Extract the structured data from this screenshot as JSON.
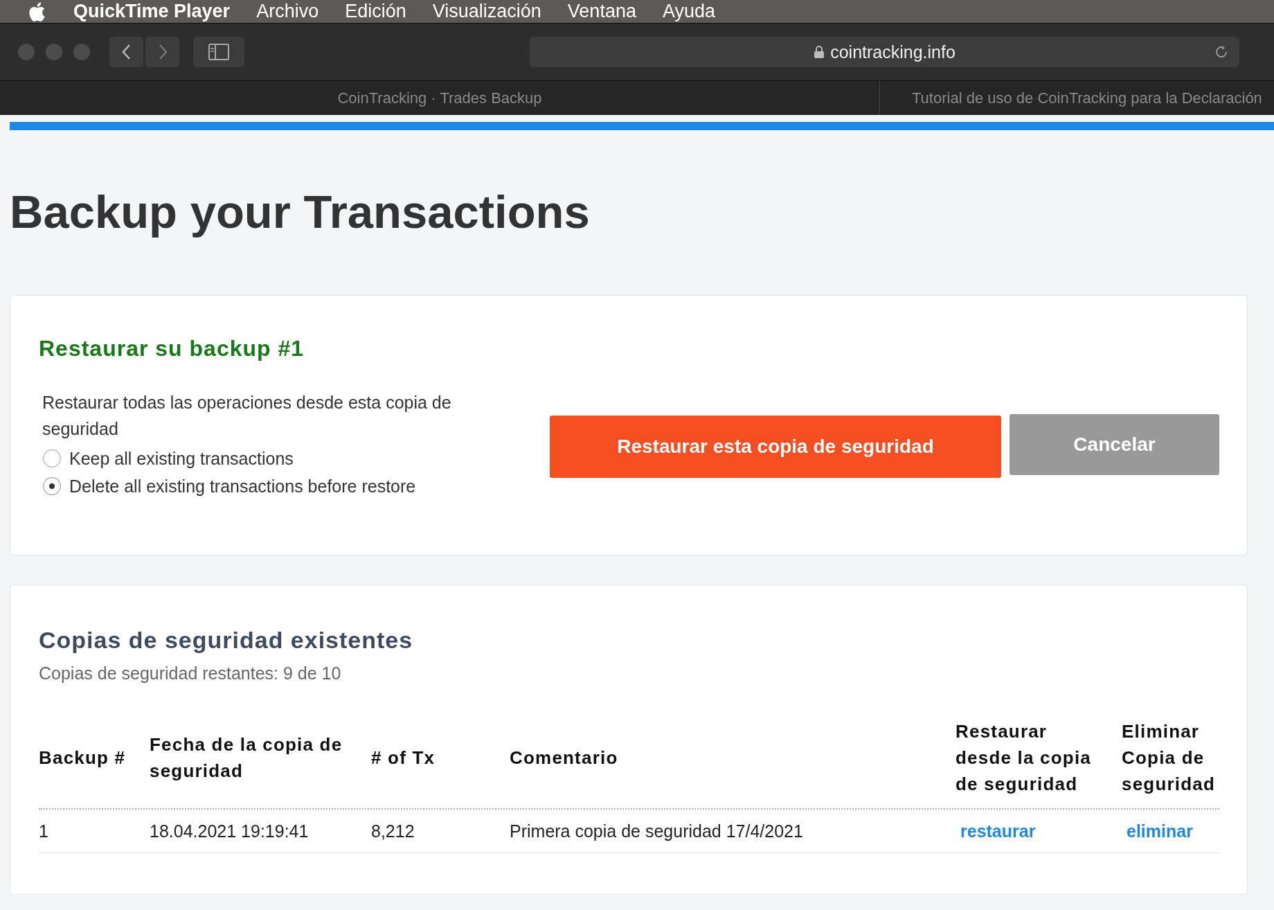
{
  "menu_bar": {
    "app": "QuickTime Player",
    "items": [
      "Archivo",
      "Edición",
      "Visualización",
      "Ventana",
      "Ayuda"
    ]
  },
  "browser": {
    "url": "cointracking.info",
    "tabs": [
      {
        "title": "CoinTracking · Trades Backup"
      },
      {
        "title": "Tutorial de uso de CoinTracking para la Declaración"
      }
    ],
    "progress": {
      "level": 1
    }
  },
  "page": {
    "title": "Backup your Transactions"
  },
  "restore_card": {
    "heading": "Restaurar su backup #1",
    "description": "Restaurar todas las operaciones desde esta copia de seguridad",
    "options": [
      {
        "label": "Keep all existing transactions",
        "selected": false
      },
      {
        "label": "Delete all existing transactions before restore",
        "selected": true
      }
    ],
    "buttons": [
      {
        "label": "Restaurar esta copia de seguridad",
        "kind": "primary"
      },
      {
        "label": "Cancelar",
        "kind": "secondary"
      }
    ]
  },
  "backups_card": {
    "heading": "Copias de seguridad existentes",
    "subtitle": "Copias de seguridad restantes: 9 de 10",
    "columns": [
      "Backup #",
      "Fecha de la copia de seguridad",
      "# of Tx",
      "Comentario",
      "Restaurar desde la copia de seguridad",
      "Eliminar Copia de seguridad"
    ],
    "rows": [
      {
        "cells": [
          {
            "text": "1",
            "kind": "text"
          },
          {
            "text": "18.04.2021 19:19:41",
            "kind": "text"
          },
          {
            "text": "8,212",
            "kind": "text"
          },
          {
            "text": "Primera copia de seguridad 17/4/2021",
            "kind": "text"
          },
          {
            "text": "restaurar",
            "kind": "link"
          },
          {
            "text": "eliminar",
            "kind": "link"
          }
        ]
      }
    ]
  }
}
